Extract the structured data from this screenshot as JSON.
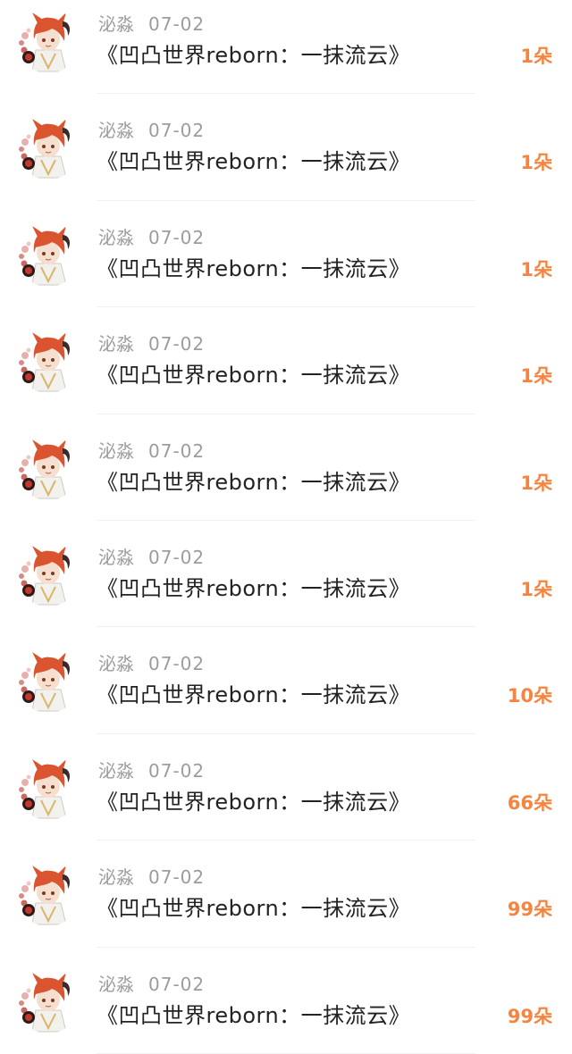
{
  "colors": {
    "name": "#9c9c9c",
    "title": "#222222",
    "gift": "#f58441",
    "divider": "#f0f0f0"
  },
  "rows": [
    {
      "user": "泌淼",
      "date": "07-02",
      "title": "《凹凸世界reborn：一抹流云》",
      "gift": "1朵",
      "avatar_icon": "anime-avatar-icon"
    },
    {
      "user": "泌淼",
      "date": "07-02",
      "title": "《凹凸世界reborn：一抹流云》",
      "gift": "1朵",
      "avatar_icon": "anime-avatar-icon"
    },
    {
      "user": "泌淼",
      "date": "07-02",
      "title": "《凹凸世界reborn：一抹流云》",
      "gift": "1朵",
      "avatar_icon": "anime-avatar-icon"
    },
    {
      "user": "泌淼",
      "date": "07-02",
      "title": "《凹凸世界reborn：一抹流云》",
      "gift": "1朵",
      "avatar_icon": "anime-avatar-icon"
    },
    {
      "user": "泌淼",
      "date": "07-02",
      "title": "《凹凸世界reborn：一抹流云》",
      "gift": "1朵",
      "avatar_icon": "anime-avatar-icon"
    },
    {
      "user": "泌淼",
      "date": "07-02",
      "title": "《凹凸世界reborn：一抹流云》",
      "gift": "1朵",
      "avatar_icon": "anime-avatar-icon"
    },
    {
      "user": "泌淼",
      "date": "07-02",
      "title": "《凹凸世界reborn：一抹流云》",
      "gift": "10朵",
      "avatar_icon": "anime-avatar-icon"
    },
    {
      "user": "泌淼",
      "date": "07-02",
      "title": "《凹凸世界reborn：一抹流云》",
      "gift": "66朵",
      "avatar_icon": "anime-avatar-icon"
    },
    {
      "user": "泌淼",
      "date": "07-02",
      "title": "《凹凸世界reborn：一抹流云》",
      "gift": "99朵",
      "avatar_icon": "anime-avatar-icon"
    },
    {
      "user": "泌淼",
      "date": "07-02",
      "title": "《凹凸世界reborn：一抹流云》",
      "gift": "99朵",
      "avatar_icon": "anime-avatar-icon"
    }
  ]
}
